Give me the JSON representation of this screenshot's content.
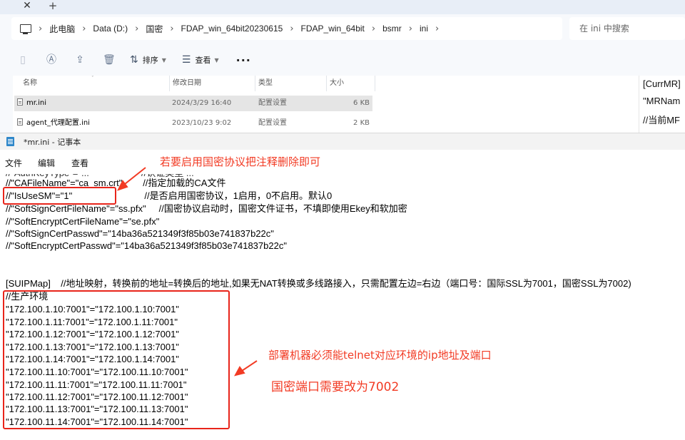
{
  "explorer": {
    "tab_close_glyph": "✕",
    "tab_new_glyph": "+",
    "breadcrumbs": [
      "此电脑",
      "Data (D:)",
      "国密",
      "FDAP_win_64bit20230615",
      "FDAP_win_64bit",
      "bsmr",
      "ini"
    ],
    "search_placeholder": "在 ini 中搜索",
    "toolbar": {
      "sort_label": "排序",
      "view_label": "查看",
      "more_glyph": "···"
    },
    "columns": [
      "名称",
      "修改日期",
      "类型",
      "大小"
    ],
    "files": [
      {
        "name": "mr.ini",
        "modified": "2024/3/29 16:40",
        "type": "配置设置",
        "size": "6 KB",
        "selected": true
      },
      {
        "name": "agent_代理配置.ini",
        "modified": "2023/10/23 9:02",
        "type": "配置设置",
        "size": "2 KB",
        "selected": false
      }
    ],
    "preview_lines": [
      "[CurrMR]",
      "\"MRNam",
      "//当前MF"
    ]
  },
  "notepad": {
    "title": "*mr.ini - 记事本",
    "menu": [
      "文件",
      "编辑",
      "查看"
    ],
    "lines": [
      "//\"CAFileName\"=\"ca_sm.crt\"        //指定加载的CA文件",
      "//\"IsUseSM\"=\"1\"                            //是否启用国密协议，1启用，0不启用。默认0",
      "//\"SoftSignCertFileName\"=\"ss.pfx\"     //国密协议启动时，国密文件证书，不填即使用Ekey和软加密",
      "//\"SoftEncryptCertFileName\"=\"se.pfx\"",
      "//\"SoftSignCertPasswd\"=\"14ba36a521349f3f85b03e741837b22c\"",
      "//\"SoftEncryptCertPasswd\"=\"14ba36a521349f3f85b03e741837b22c\"",
      "",
      "",
      "[SUIPMap]    //地址映射，转换前的地址=转换后的地址,如果无NAT转换或多线路接入，只需配置左边=右边（端口号：国际SSL为7001，国密SSL为7002)",
      "//生产环境",
      "\"172.100.1.10:7001\"=\"172.100.1.10:7001\"",
      "\"172.100.1.11:7001\"=\"172.100.1.11:7001\"",
      "\"172.100.1.12:7001\"=\"172.100.1.12:7001\"",
      "\"172.100.1.13:7001\"=\"172.100.1.13:7001\"",
      "\"172.100.1.14:7001\"=\"172.100.1.14:7001\"",
      "\"172.100.11.10:7001\"=\"172.100.11.10:7001\"",
      "\"172.100.11.11:7001\"=\"172.100.11.11:7001\"",
      "\"172.100.11.12:7001\"=\"172.100.11.12:7001\"",
      "\"172.100.11.13:7001\"=\"172.100.11.13:7001\"",
      "\"172.100.11.14:7001\"=\"172.100.11.14:7001\""
    ]
  },
  "annotations": {
    "top_note": "若要启用国密协议把注释删除即可",
    "machines_note": "部署机器必须能telnet对应环境的ip地址及端口",
    "port_note": "国密端口需要改为7002",
    "color": "#f23b24"
  }
}
